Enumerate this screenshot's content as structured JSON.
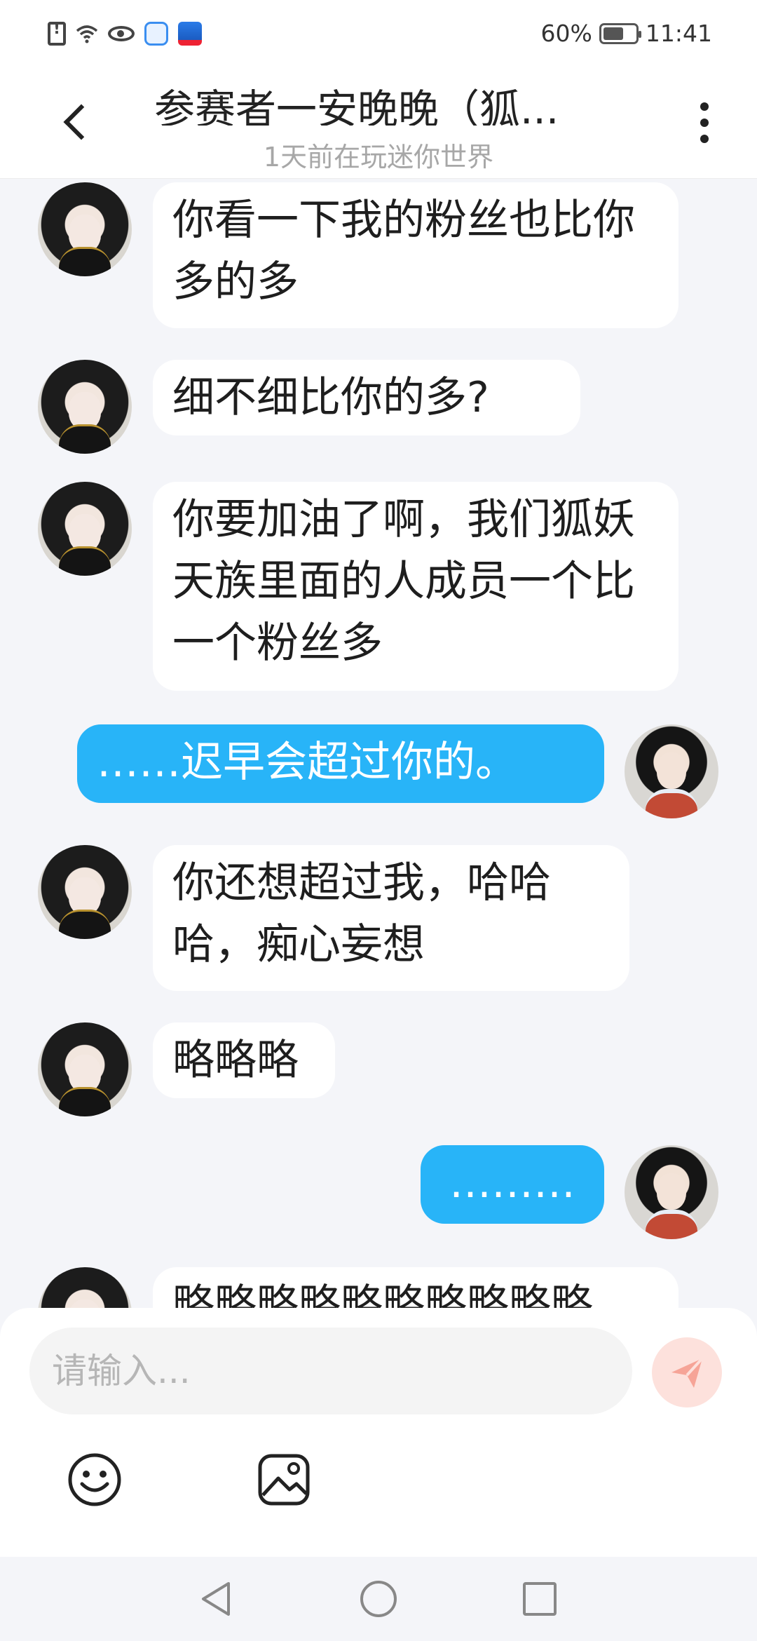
{
  "status_bar": {
    "battery_text": "60%",
    "time": "11:41"
  },
  "header": {
    "title": "参赛者一安晚晚（狐...",
    "subtitle": "1天前在玩迷你世界"
  },
  "messages": [
    {
      "sender": "other",
      "text": "你看一下我的粉丝也比你多的多"
    },
    {
      "sender": "other",
      "text": "细不细比你的多?"
    },
    {
      "sender": "other",
      "text": "你要加油了啊，我们狐妖天族里面的人成员一个比一个粉丝多"
    },
    {
      "sender": "me",
      "text": "……迟早会超过你的。"
    },
    {
      "sender": "other",
      "text": "你还想超过我，哈哈哈，痴心妄想"
    },
    {
      "sender": "other",
      "text": "略略略"
    },
    {
      "sender": "me",
      "text": "………"
    },
    {
      "sender": "other",
      "text": "略略略略略略略略略略"
    }
  ],
  "input": {
    "placeholder": "请输入..."
  },
  "colors": {
    "my_bubble": "#28b4f8",
    "other_bubble": "#ffffff",
    "send_button_bg": "#fde1dc",
    "send_icon": "#f6a497"
  },
  "icons": {
    "back": "chevron-left-icon",
    "more": "more-vertical-icon",
    "emoji": "smiley-icon",
    "image": "image-icon",
    "send": "paper-plane-icon",
    "nav_back": "triangle-back-icon",
    "nav_home": "circle-home-icon",
    "nav_recents": "square-recents-icon"
  }
}
